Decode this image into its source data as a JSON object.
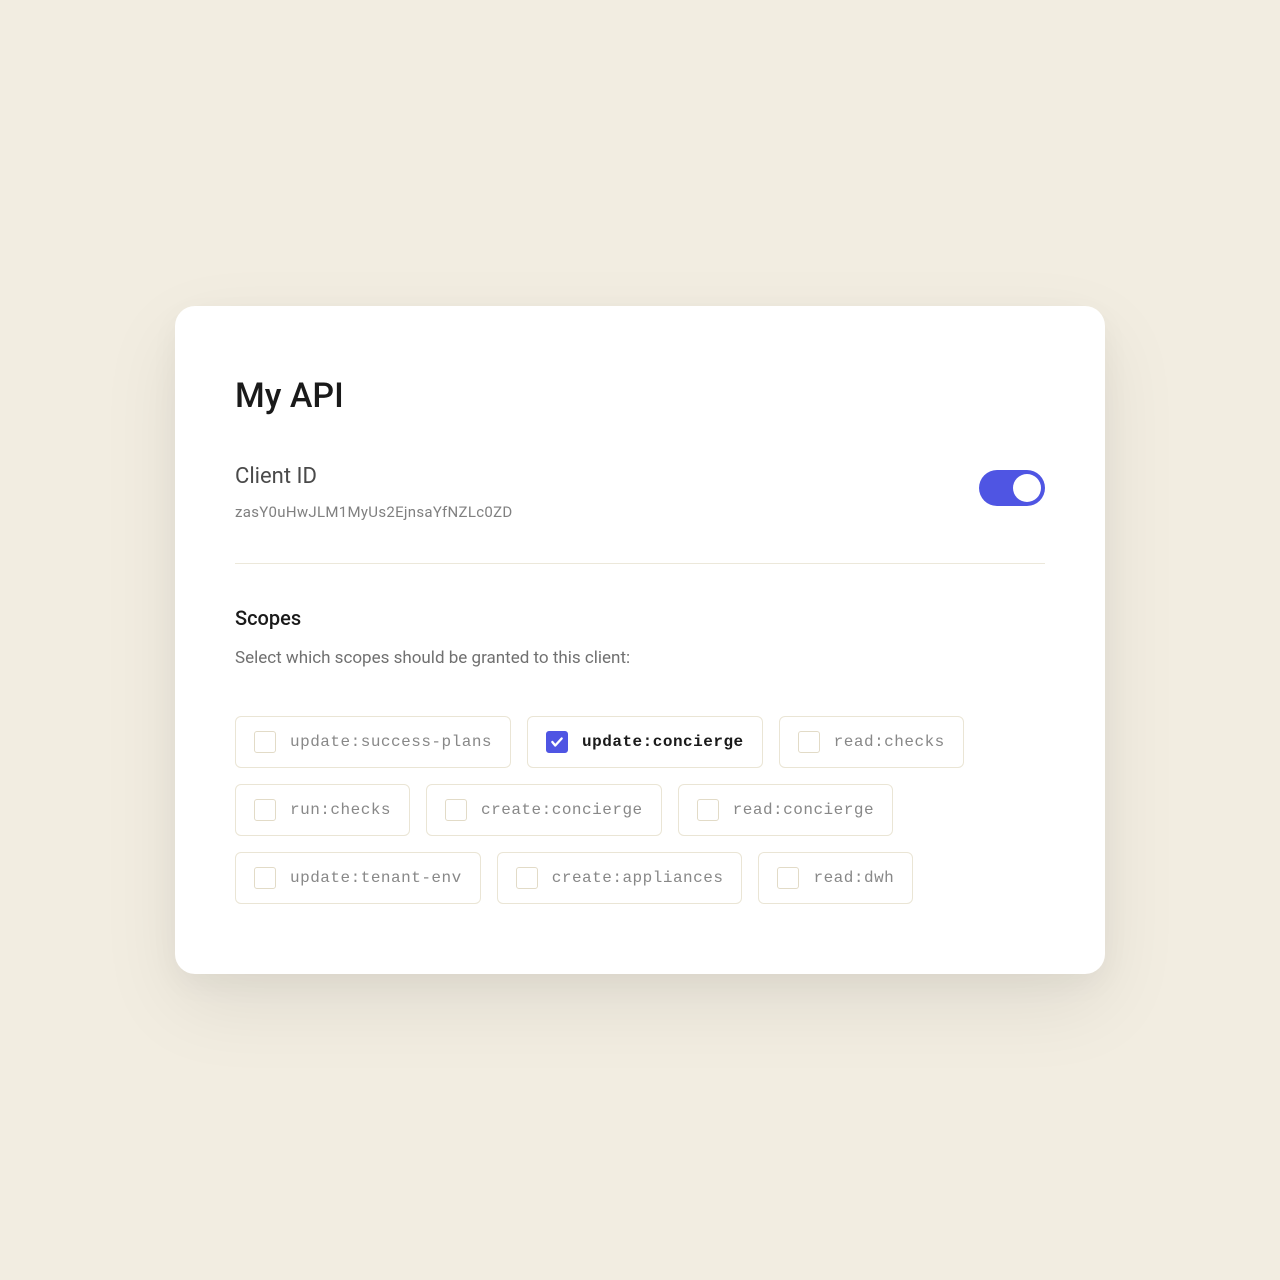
{
  "title": "My API",
  "client": {
    "label": "Client ID",
    "value": "zasY0uHwJLM1MyUs2EjnsaYfNZLc0ZD",
    "enabled": true
  },
  "scopes": {
    "heading": "Scopes",
    "description": "Select which scopes should be granted to this client:",
    "items": [
      {
        "label": "update:success-plans",
        "checked": false
      },
      {
        "label": "update:concierge",
        "checked": true
      },
      {
        "label": "read:checks",
        "checked": false
      },
      {
        "label": "run:checks",
        "checked": false
      },
      {
        "label": "create:concierge",
        "checked": false
      },
      {
        "label": "read:concierge",
        "checked": false
      },
      {
        "label": "update:tenant-env",
        "checked": false
      },
      {
        "label": "create:appliances",
        "checked": false
      },
      {
        "label": "read:dwh",
        "checked": false
      }
    ]
  },
  "colors": {
    "accent": "#4f55e3",
    "background": "#f2ede1",
    "card": "#ffffff"
  }
}
